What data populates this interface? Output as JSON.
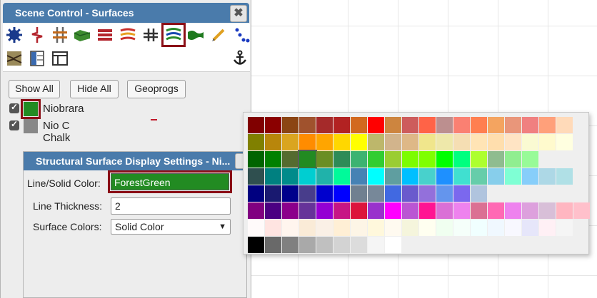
{
  "panel": {
    "title": "Scene Control - Surfaces",
    "close_glyph": "✖"
  },
  "toolbar": {
    "row1": [
      {
        "icon": "gear-icon",
        "color": "#1a3a8c"
      },
      {
        "icon": "well-trajectory-icon",
        "color": "#b3262e"
      },
      {
        "icon": "well-markers-icon",
        "color": "#c26a1a"
      },
      {
        "icon": "surface-3d-icon",
        "color": "#3c8a2e"
      },
      {
        "icon": "grid-stack-icon",
        "color": "#b3262e"
      },
      {
        "icon": "horizon-lines-icon",
        "color": "#c9302c"
      },
      {
        "icon": "fault-icon",
        "color": "#333333"
      },
      {
        "icon": "surfaces-icon",
        "color": "#2a7a2a",
        "selected": true
      },
      {
        "icon": "green-surface-icon",
        "color": "#1e7a1e"
      },
      {
        "icon": "pencil-icon",
        "color": "#e0a020"
      },
      {
        "icon": "scatter-points-icon",
        "color": "#1a3ac0"
      }
    ],
    "row2": [
      {
        "icon": "cross-section-icon",
        "color": "#6b5a2a"
      },
      {
        "icon": "panel-split-icon",
        "color": "#3a6ab0"
      },
      {
        "icon": "layout-window-icon",
        "color": "#333333"
      }
    ],
    "anchor_icon": "anchor-icon"
  },
  "buttons": {
    "show_all": "Show All",
    "hide_all": "Hide All",
    "geoprogs": "Geoprogs"
  },
  "layers": [
    {
      "label": "Niobrara",
      "color": "#228b22",
      "checked": true,
      "selected": true
    },
    {
      "label": "Nio C Chalk",
      "color": "#888888",
      "checked": true,
      "selected": false
    }
  ],
  "settings": {
    "title": "Structural Surface Display Settings - Ni...",
    "line_color_label": "Line/Solid Color:",
    "line_color_value": "ForestGreen",
    "line_color_hex": "#228b22",
    "thickness_label": "Line Thickness:",
    "thickness_value": "2",
    "surface_colors_label": "Surface Colors:",
    "surface_colors_value": "Solid Color"
  },
  "palette": {
    "selected": "#228b22",
    "rows": [
      [
        "#800000",
        "#8b0000",
        "#8b4513",
        "#a0522d",
        "#a52a2a",
        "#b22222",
        "#d2691e",
        "#ff0000",
        "#cd853f",
        "#cd5c5c",
        "#ff6347",
        "#bc8f8f",
        "#fa8072",
        "#ff7f50",
        "#f4a460",
        "#e9967a",
        "#f08080",
        "#ffa07a",
        "#ffdab9"
      ],
      [
        "#808000",
        "#b8860b",
        "#daa520",
        "#ff8c00",
        "#ffa500",
        "#ffd700",
        "#ffff00",
        "#bdb76b",
        "#d2b48c",
        "#deb887",
        "#f0e68c",
        "#eee8aa",
        "#f5deb3",
        "#ffe4b5",
        "#ffdead",
        "#ffe4c4",
        "#fafad2",
        "#fffacd",
        "#ffffe0"
      ],
      [
        "#006400",
        "#008000",
        "#556b2f",
        "#228b22",
        "#6b8e23",
        "#2e8b57",
        "#3cb371",
        "#32cd32",
        "#9acd32",
        "#7cfc00",
        "#7fff00",
        "#00ff00",
        "#00ff7f",
        "#adff2f",
        "#8fbc8f",
        "#90ee90",
        "#98fb98"
      ],
      [
        "#2f4f4f",
        "#008080",
        "#008b8b",
        "#00ced1",
        "#20b2aa",
        "#00fa9a",
        "#4682b4",
        "#00ffff",
        "#5f9ea0",
        "#00bfff",
        "#48d1cc",
        "#1e90ff",
        "#40e0d0",
        "#66cdaa",
        "#87ceeb",
        "#7fffd4",
        "#87cefa",
        "#add8e6",
        "#b0e0e6"
      ],
      [
        "#000080",
        "#191970",
        "#00008b",
        "#483d8b",
        "#0000cd",
        "#0000ff",
        "#708090",
        "#778899",
        "#4169e1",
        "#6a5acd",
        "#9370db",
        "#6495ed",
        "#7b68ee",
        "#b0c4de"
      ],
      [
        "#800080",
        "#4b0082",
        "#8b008b",
        "#663399",
        "#9400d3",
        "#c71585",
        "#dc143c",
        "#9932cc",
        "#ff00ff",
        "#ba55d3",
        "#ff1493",
        "#da70d6",
        "#ee82ee",
        "#db7093",
        "#ff69b4",
        "#ee82ee",
        "#dda0dd",
        "#d8bfd8",
        "#ffb6c1",
        "#ffc0cb"
      ],
      [
        "#fffafa",
        "#ffe4e1",
        "#fff5ee",
        "#faebd7",
        "#faf0e6",
        "#ffefd5",
        "#fdf5e6",
        "#fff8dc",
        "#fffaf0",
        "#f5f5dc",
        "#fffff0",
        "#f0fff0",
        "#f5fffa",
        "#f0ffff",
        "#f0f8ff",
        "#f8f8ff",
        "#e6e6fa",
        "#fff0f5",
        "#f5f5f5"
      ],
      [
        "#000000",
        "#696969",
        "#808080",
        "#a9a9a9",
        "#c0c0c0",
        "#d3d3d3",
        "#dcdcdc",
        "#f5f5f5",
        "#ffffff"
      ]
    ]
  }
}
